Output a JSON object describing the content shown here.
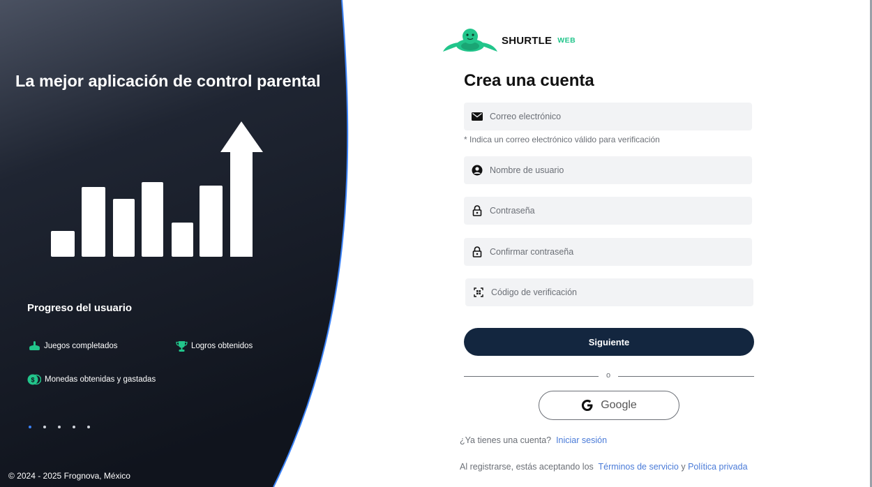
{
  "left": {
    "headline": "La mejor aplicación de control parental",
    "progress_title": "Progreso del usuario",
    "features": [
      {
        "label": "Juegos completados",
        "icon": "game-controller-icon"
      },
      {
        "label": "Logros obtenidos",
        "icon": "trophy-icon"
      },
      {
        "label": "Monedas obtenidas y gastadas",
        "icon": "coins-icon"
      }
    ],
    "carousel_count": 5,
    "carousel_active": 1,
    "copyright": "© 2024 - 2025 Frognova, México",
    "colors": {
      "panel_top": "#444b5a",
      "panel_bottom": "#10141d",
      "accent_edge": "#3b82f6",
      "icon_green": "#22c58b"
    }
  },
  "logo": {
    "name": "SHURTLE",
    "sub": "WEB",
    "icon": "turtle-logo-icon"
  },
  "form": {
    "title": "Crea una cuenta",
    "email_placeholder": "Correo electrónico",
    "email_hint": "* Indica un correo electrónico válido para verificación",
    "username_placeholder": "Nombre de usuario",
    "password_placeholder": "Contraseña",
    "confirm_placeholder": "Confirmar contraseña",
    "code_placeholder": "Código de verificación",
    "next_button": "Siguiente",
    "divider": "o",
    "google_button": "Google"
  },
  "footer": {
    "have_account": "¿Ya tienes una cuenta?",
    "login_link": "Iniciar sesión",
    "agree_text": "Al registrarse, estás aceptando los",
    "terms_link": "Términos de servicio",
    "and_text": "y",
    "privacy_link": "Política privada"
  },
  "colors": {
    "primary_button": "#13263f",
    "link": "#4a7bd8",
    "field_bg": "#f2f3f5",
    "muted_text": "#6b6f76"
  }
}
